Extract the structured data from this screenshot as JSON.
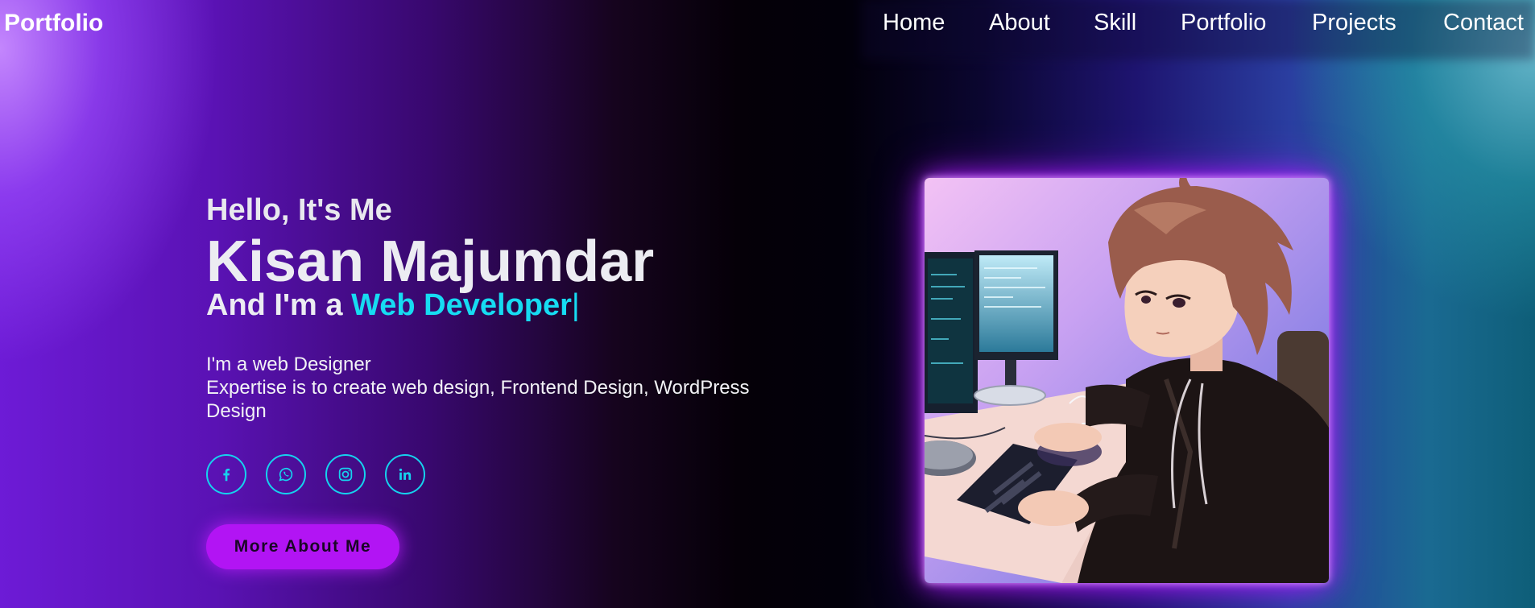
{
  "nav": {
    "logo": "Portfolio",
    "links": [
      "Home",
      "About",
      "Skill",
      "Portfolio",
      "Projects",
      "Contact"
    ]
  },
  "hero": {
    "greeting": "Hello, It's Me",
    "name": "Kisan Majumdar",
    "role_prefix": "And I'm a ",
    "role_highlight": "Web Developer",
    "caret": "|",
    "description_line1": "I'm a web Designer",
    "description_line2": "Expertise is to create web design, Frontend Design, WordPress Design",
    "cta_label": "More About Me"
  },
  "socials": [
    {
      "icon": "facebook-icon"
    },
    {
      "icon": "whatsapp-icon"
    },
    {
      "icon": "instagram-icon"
    },
    {
      "icon": "linkedin-icon"
    }
  ],
  "colors": {
    "accent": "#16dcf2",
    "button": "#b214f4",
    "glow": "#b01cff"
  }
}
